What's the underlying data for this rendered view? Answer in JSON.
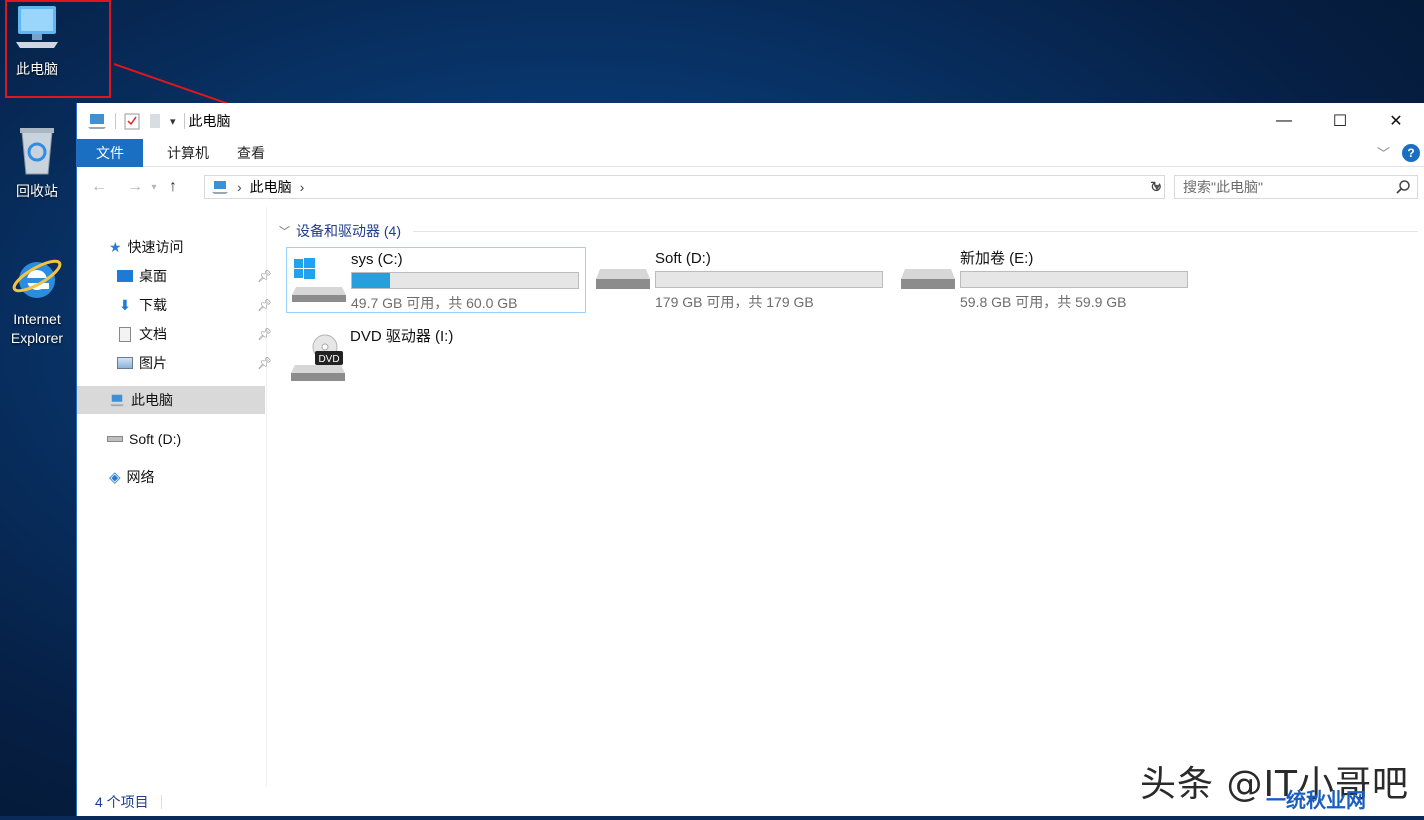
{
  "desktop": {
    "icons": [
      {
        "label": "此电脑"
      },
      {
        "label": "回收站"
      },
      {
        "label": "Internet Explorer"
      }
    ]
  },
  "window": {
    "title": "此电脑",
    "controls": {
      "minimize": "—",
      "maximize": "☐",
      "close": "✕"
    },
    "ribbon": {
      "tabs": [
        {
          "label": "文件"
        },
        {
          "label": "计算机"
        },
        {
          "label": "查看"
        }
      ],
      "help": "?"
    },
    "address": {
      "crumbs": [
        "此电脑"
      ]
    },
    "search": {
      "placeholder": "搜索\"此电脑\""
    },
    "nav_pane": {
      "quick_access": "快速访问",
      "items": [
        {
          "label": "桌面"
        },
        {
          "label": "下载"
        },
        {
          "label": "文档"
        },
        {
          "label": "图片"
        }
      ],
      "this_pc": "此电脑",
      "drive": "Soft (D:)",
      "network": "网络"
    },
    "content": {
      "group_title": "设备和驱动器 (4)",
      "drives": [
        {
          "name": "sys (C:)",
          "size_text": "49.7 GB 可用，共 60.0 GB",
          "used_fraction": 0.17,
          "icon": "windows-drive-icon"
        },
        {
          "name": "Soft (D:)",
          "size_text": "179 GB 可用，共 179 GB",
          "used_fraction": 0.0,
          "icon": "hard-drive-icon"
        },
        {
          "name": "新加卷 (E:)",
          "size_text": "59.8 GB 可用，共 59.9 GB",
          "used_fraction": 0.0,
          "icon": "hard-drive-icon"
        },
        {
          "name": "DVD 驱动器 (I:)",
          "icon": "dvd-drive-icon",
          "badge": "DVD"
        }
      ]
    },
    "status": {
      "count": "4 个项目"
    }
  },
  "watermark": {
    "text": "头条 @IT小哥吧",
    "logo_text": "一统秋业网"
  },
  "colors": {
    "accent": "#1a6fc2",
    "annotation": "#e0161e",
    "progress": "#26a0da"
  }
}
